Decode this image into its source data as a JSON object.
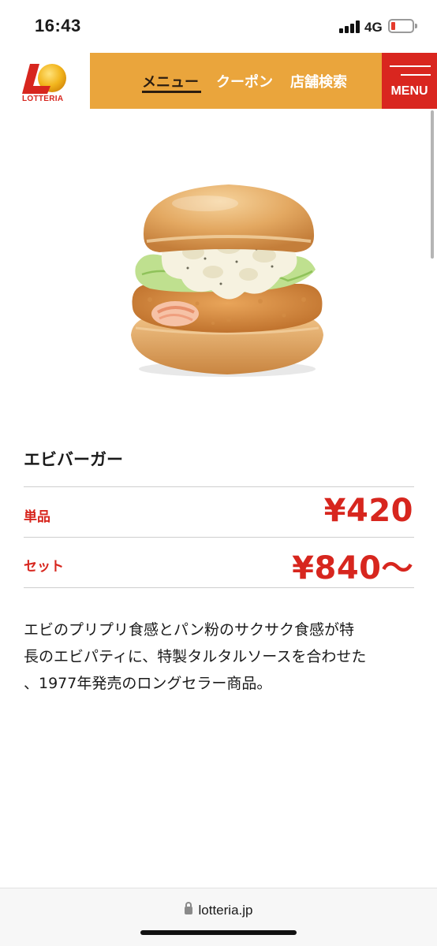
{
  "status_bar": {
    "time": "16:43",
    "network": "4G",
    "signal_icon": "cellular-signal-icon",
    "battery_icon": "battery-low-icon"
  },
  "header": {
    "logo_text": "LOTTERIA",
    "nav": [
      {
        "label": "メニュー",
        "active": true
      },
      {
        "label": "クーポン",
        "active": false
      },
      {
        "label": "店舗検索",
        "active": false
      }
    ],
    "menu_button": "MENU",
    "colors": {
      "nav_bg": "#eaa53c",
      "menu_bg": "#d9261f",
      "brand_red": "#d7261e"
    }
  },
  "product": {
    "image_icon": "shrimp-burger-image",
    "name": "エビバーガー",
    "prices": [
      {
        "label": "単品",
        "value": "¥420"
      },
      {
        "label": "セット",
        "value": "¥840〜"
      }
    ],
    "description_lines": [
      "エビのプリプリ食感とパン粉のサクサク食感が特",
      "長のエビパティに、特製タルタルソースを合わせた",
      "、1977年発売のロングセラー商品。"
    ]
  },
  "browser": {
    "url": "lotteria.jp",
    "lock_icon": "lock-icon"
  }
}
